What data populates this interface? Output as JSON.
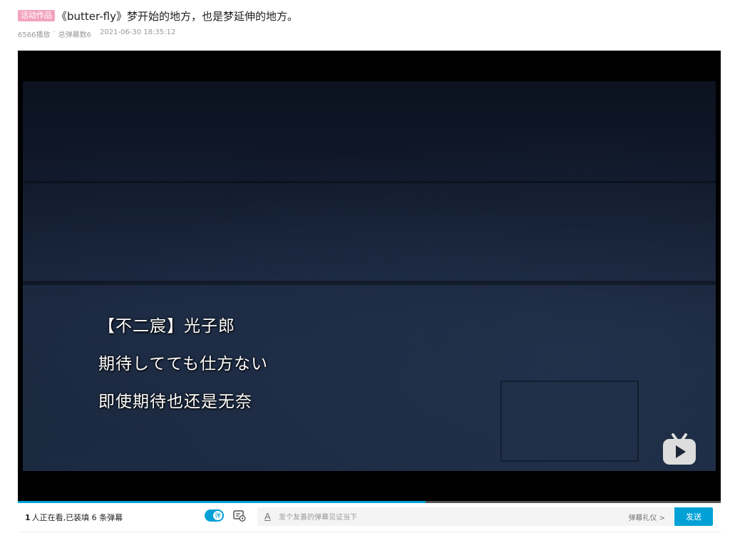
{
  "video": {
    "tag": "活动作品",
    "title": "《butter-fly》梦开始的地方，也是梦延伸的地方。",
    "plays": "6566播放",
    "separator": "·",
    "danmaku_total": "总弹幕数6",
    "published": "2021-06-30 18:35:12"
  },
  "player": {
    "subtitles": [
      "【不二宸】光子郎",
      "期待してても仕方ない",
      "即使期待也还是无奈"
    ],
    "watermark_icon": "bilibili-tv-icon",
    "progress_fraction": 0.58
  },
  "controls": {
    "viewers_count": "1",
    "viewers_text": "人正在看,已装填 6 条弹幕",
    "toggle_label": "弹",
    "font_icon_label": "A",
    "danmu_placeholder": "发个友善的弹幕见证当下",
    "etiquette_label": "弹幕礼仪 >",
    "send_label": "发送"
  },
  "colors": {
    "accent": "#00a1d6",
    "tag_pink": "#f3a3bd"
  }
}
